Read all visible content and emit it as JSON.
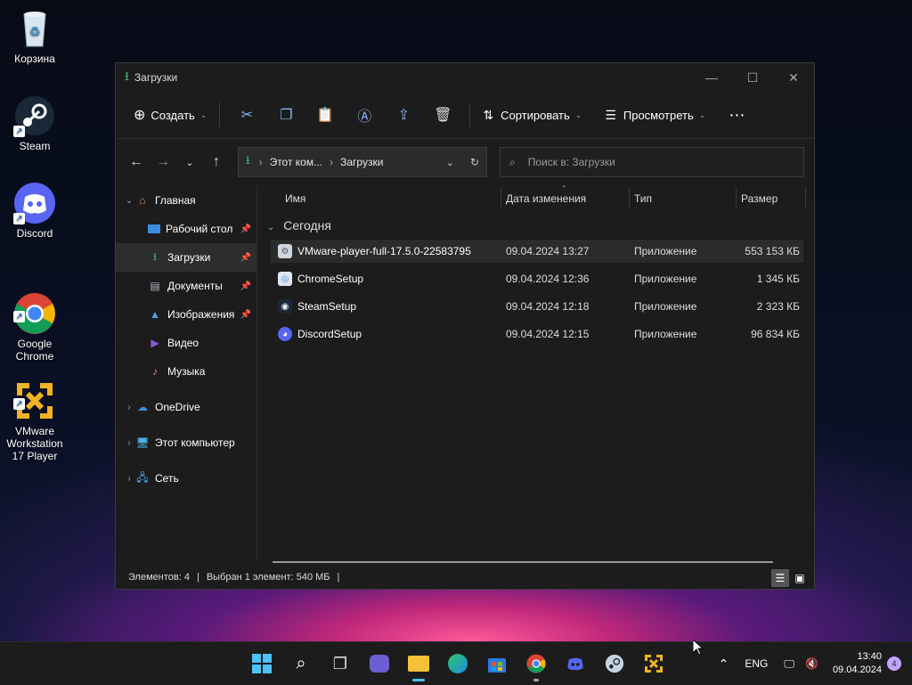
{
  "desktop": {
    "icons": [
      {
        "label": "Корзина"
      },
      {
        "label": "Steam"
      },
      {
        "label": "Discord"
      },
      {
        "label": "Google\nChrome"
      },
      {
        "label": "VMware\nWorkstation\n17 Player"
      }
    ]
  },
  "window": {
    "title": "Загрузки",
    "toolbar": {
      "create_label": "Создать",
      "sort_label": "Сортировать",
      "view_label": "Просмотреть"
    },
    "address": {
      "crumb1": "Этот ком...",
      "crumb2": "Загрузки"
    },
    "search": {
      "placeholder": "Поиск в: Загрузки"
    },
    "sidebar": {
      "items": [
        {
          "label": "Главная"
        },
        {
          "label": "Рабочий стол"
        },
        {
          "label": "Загрузки"
        },
        {
          "label": "Документы"
        },
        {
          "label": "Изображения"
        },
        {
          "label": "Видео"
        },
        {
          "label": "Музыка"
        },
        {
          "label": "OneDrive"
        },
        {
          "label": "Этот компьютер"
        },
        {
          "label": "Сеть"
        }
      ]
    },
    "columns": {
      "name": "Имя",
      "date": "Дата изменения",
      "type": "Тип",
      "size": "Размер"
    },
    "group_label": "Сегодня",
    "files": [
      {
        "name": "VMware-player-full-17.5.0-22583795",
        "date": "09.04.2024 13:27",
        "type": "Приложение",
        "size": "553 153 КБ"
      },
      {
        "name": "ChromeSetup",
        "date": "09.04.2024 12:36",
        "type": "Приложение",
        "size": "1 345 КБ"
      },
      {
        "name": "SteamSetup",
        "date": "09.04.2024 12:18",
        "type": "Приложение",
        "size": "2 323 КБ"
      },
      {
        "name": "DiscordSetup",
        "date": "09.04.2024 12:15",
        "type": "Приложение",
        "size": "96 834 КБ"
      }
    ],
    "status": {
      "count": "Элементов: 4",
      "selected": "Выбран 1 элемент: 540 МБ"
    }
  },
  "taskbar": {
    "lang": "ENG",
    "time": "13:40",
    "date": "09.04.2024",
    "notifications": "4"
  },
  "colors": {
    "accent_green": "#3dbb6a",
    "folder_yellow": "#f3c13a",
    "discord": "#5865f2"
  }
}
